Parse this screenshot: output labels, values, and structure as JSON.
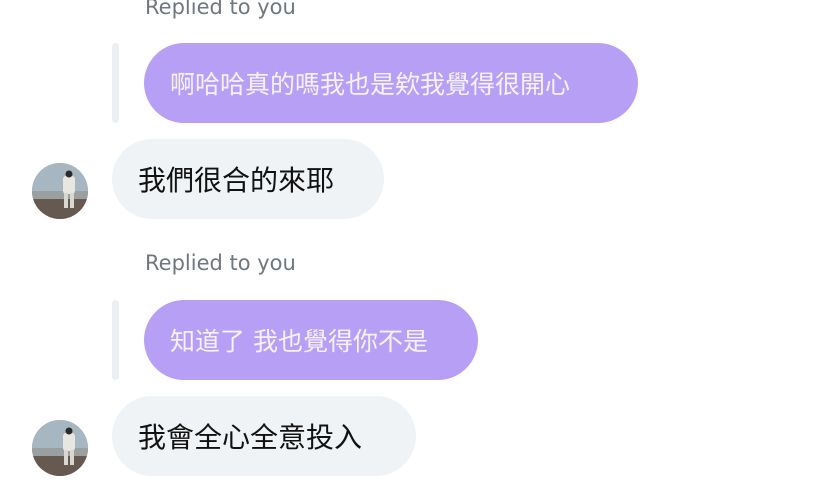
{
  "conversation": {
    "threads": [
      {
        "replied_label": "Replied to you",
        "quoted_text": "啊哈哈真的嗎我也是欸我覺得很開心",
        "reply_text": "我們很合的來耶"
      },
      {
        "replied_label": "Replied to you",
        "quoted_text": "知道了 我也覺得你不是",
        "reply_text": "我會全心全意投入"
      }
    ]
  },
  "colors": {
    "quoted_bubble": "#b49cf4",
    "message_bubble": "#eff3f5",
    "reply_bar": "#eceff1",
    "label_text": "#6f7780"
  },
  "icons": {
    "avatar": "profile-photo"
  }
}
